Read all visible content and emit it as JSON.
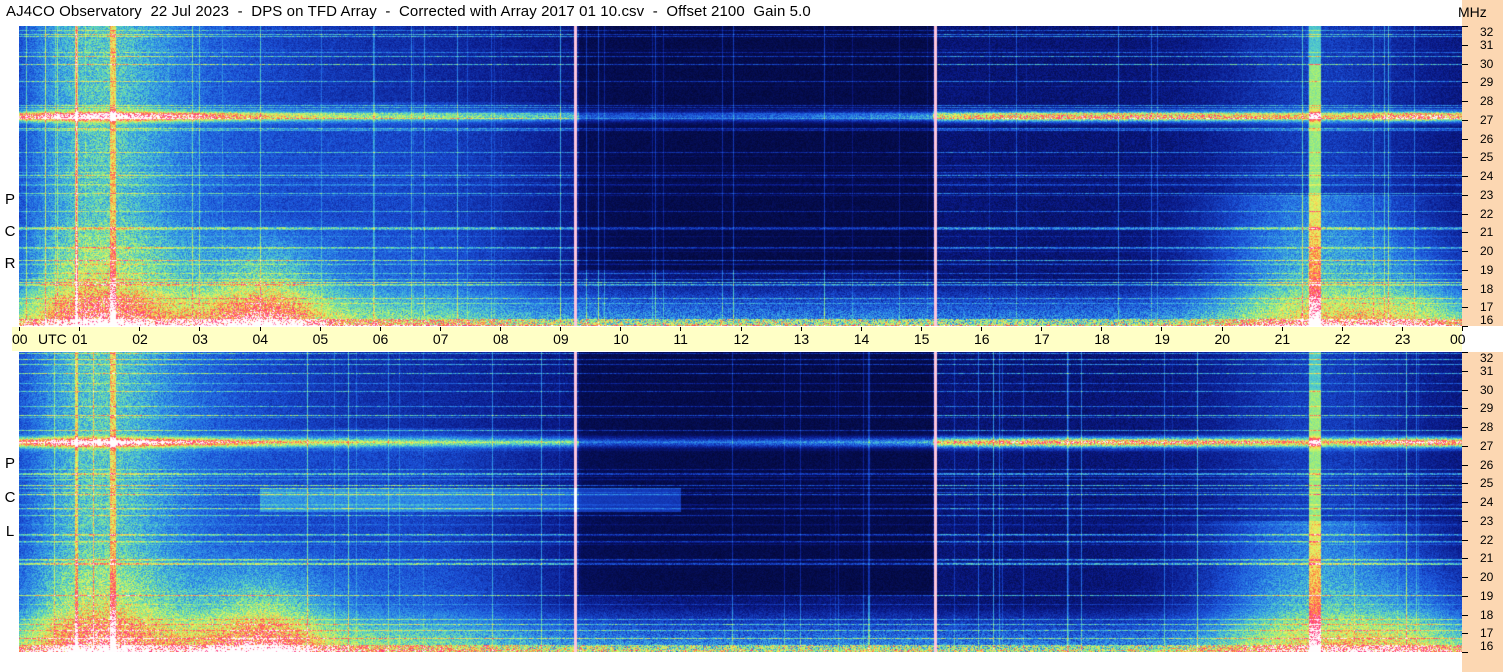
{
  "title": "AJ4CO Observatory  22 Jul 2023  -  DPS on TFD Array  -  Corrected with Array 2017 01 10.csv  -  Offset 2100  Gain 5.0",
  "panels": [
    {
      "id": "rcp",
      "label_letters": [
        "R",
        "C",
        "P"
      ]
    },
    {
      "id": "lcp",
      "label_letters": [
        "L",
        "C",
        "P"
      ]
    }
  ],
  "time_axis": {
    "unit_label": "UTC",
    "freq_unit_label": "MHz",
    "ticks": [
      "00",
      "01",
      "02",
      "03",
      "04",
      "05",
      "06",
      "07",
      "08",
      "09",
      "10",
      "11",
      "12",
      "13",
      "14",
      "15",
      "16",
      "17",
      "18",
      "19",
      "20",
      "21",
      "22",
      "23",
      "00"
    ]
  },
  "chart_data": {
    "type": "heatmap",
    "title": "AJ4CO Observatory  22 Jul 2023  -  DPS on TFD Array  -  Corrected with Array 2017 01 10.csv  -  Offset 2100  Gain 5.0",
    "x": {
      "label": "UTC",
      "range_hours": [
        0,
        24
      ],
      "tick_labels": [
        "00",
        "01",
        "02",
        "03",
        "04",
        "05",
        "06",
        "07",
        "08",
        "09",
        "10",
        "11",
        "12",
        "13",
        "14",
        "15",
        "16",
        "17",
        "18",
        "19",
        "20",
        "21",
        "22",
        "23",
        "00"
      ]
    },
    "y": {
      "label": "MHz",
      "range": [
        16,
        32
      ],
      "tick_labels": [
        "16",
        "17",
        "18",
        "19",
        "20",
        "21",
        "22",
        "23",
        "24",
        "25",
        "26",
        "27",
        "28",
        "29",
        "30",
        "31",
        "32"
      ]
    },
    "series": [
      {
        "name": "RCP",
        "notes_features": {
          "strong_band_mhz": 27.2,
          "enhanced_hours": [
            [
              0.5,
              2.2
            ],
            [
              3.5,
              5
            ],
            [
              19.8,
              23
            ]
          ],
          "vertical_lines_hours": [
            9.25,
            15.25
          ]
        }
      },
      {
        "name": "LCP",
        "notes_features": {
          "strong_band_mhz": 27.2,
          "enhanced_hours": [
            [
              0.5,
              2.2
            ],
            [
              3.5,
              5
            ],
            [
              19.8,
              23
            ]
          ],
          "vertical_lines_hours": [
            9.25,
            15.25
          ]
        }
      }
    ],
    "colorscale": [
      "#000018",
      "#0a1a8a",
      "#1a4fd6",
      "#2f8fe8",
      "#55d0c8",
      "#a8f070",
      "#f0f060",
      "#ff8040",
      "#ff3080",
      "#ffffff"
    ]
  }
}
